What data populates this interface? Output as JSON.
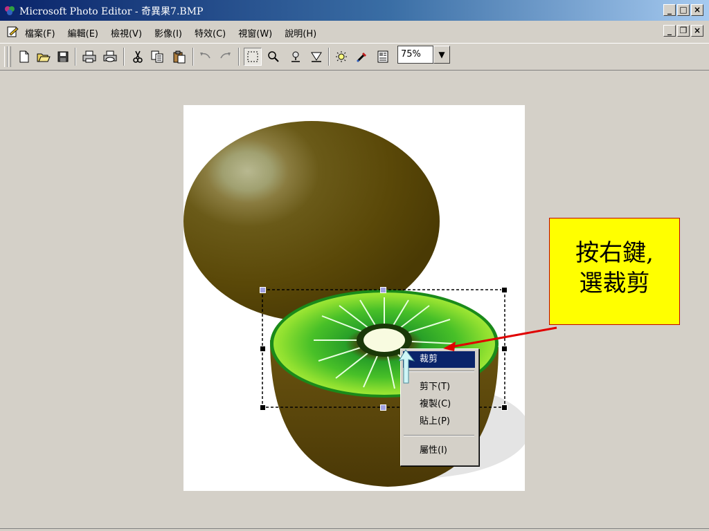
{
  "window": {
    "title": "Microsoft Photo Editor - 奇異果7.BMP",
    "buttons": {
      "minimize": "_",
      "maximize": "□",
      "close": "×"
    }
  },
  "menubar": {
    "items": [
      "檔案(F)",
      "編輯(E)",
      "檢視(V)",
      "影像(I)",
      "特效(C)",
      "視窗(W)",
      "說明(H)"
    ],
    "mdi_buttons": {
      "minimize": "_",
      "restore": "❐",
      "close": "×"
    }
  },
  "toolbar": {
    "zoom_value": "75%",
    "zoom_dropdown": "▼",
    "buttons": [
      "new-icon",
      "open-icon",
      "save-icon",
      "print-icon",
      "print-preview-icon",
      "cut-icon",
      "copy-icon",
      "paste-icon",
      "undo-icon",
      "redo-icon",
      "select-icon",
      "zoom-icon",
      "smudge-icon",
      "sharpen-icon",
      "balance-icon",
      "eyedropper-icon",
      "properties-icon"
    ]
  },
  "context_menu": {
    "items": [
      {
        "label": "裁剪",
        "active": true
      },
      {
        "label": "剪下(T)"
      },
      {
        "label": "複製(C)"
      },
      {
        "label": "貼上(P)"
      },
      {
        "label": "屬性(I)"
      }
    ]
  },
  "callout": {
    "line1": "按右鍵,",
    "line2": "選裁剪"
  },
  "colors": {
    "title_gradient_start": "#0a246a",
    "title_gradient_end": "#a6caf0",
    "callout_bg": "#ffff00",
    "arrow": "#e00000",
    "kiwi_skin": "#5c4a0a",
    "kiwi_flesh": "#7ed321"
  }
}
